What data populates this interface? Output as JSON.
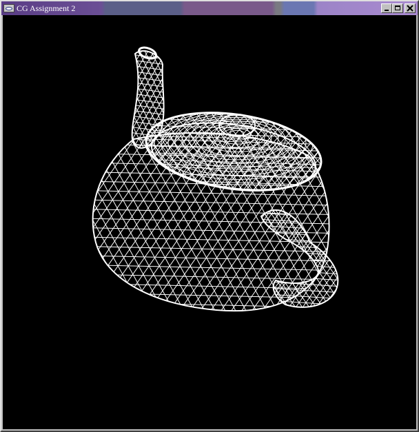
{
  "window": {
    "title": "CG Assignment 2",
    "icon": "app-window-icon",
    "controls": {
      "minimize_icon": "minimize-icon",
      "maximize_icon": "maximize-icon",
      "close_icon": "close-icon"
    }
  },
  "viewport": {
    "background_color": "#000000",
    "wireframe_color": "#ffffff",
    "object": "teapot-wireframe"
  }
}
